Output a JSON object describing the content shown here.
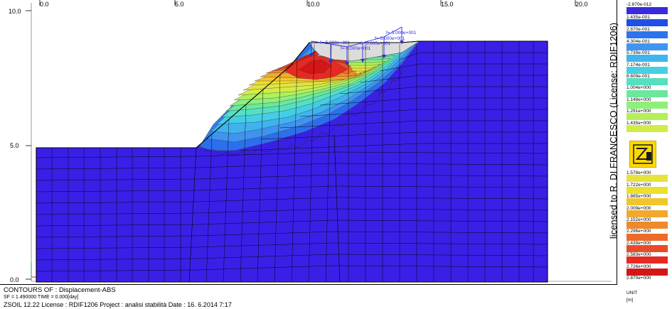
{
  "x_axis": {
    "ticks": [
      "0.0",
      "5.0",
      "10.0",
      "15.0",
      "20.0"
    ]
  },
  "y_axis": {
    "ticks": [
      "10.0",
      "5.0",
      "0.0"
    ]
  },
  "load_labels": [
    "f=-5.000e+001",
    "f=-5.000e+001",
    "f=-5.000e+001",
    "f=-5.000e+001",
    "f=-5.000e+001"
  ],
  "info": {
    "line1": "CONTOURS OF : Displacement-ABS",
    "line2": "SF = 1.490000   TIME = 0.000[day]",
    "line3": "ZSOIL 12.22   License :  RDIF1206   Project : analisi stabilità     Date : 16. 6.2014   7:17"
  },
  "legend": {
    "license_text": "licensed to R. DI FRANCESCO (License: RDIF1206)",
    "labels": [
      "-2.870e-012",
      "1.435e-001",
      "2.870e-001",
      "4.304e-001",
      "5.739e-001",
      "7.174e-001",
      "8.609e-001",
      "1.004e+000",
      "1.148e+000",
      "1.291e+000",
      "1.435e+000",
      "1.578e+000",
      "1.722e+000",
      "1.865e+000",
      "2.009e+000",
      "2.152e+000",
      "2.296e+000",
      "2.439e+000",
      "2.583e+000",
      "2.726e+000",
      "2.870e+000"
    ],
    "colors": [
      "#3a2ae0",
      "#1f4fe6",
      "#2b74ec",
      "#3f96f0",
      "#3fb4ee",
      "#45d0e4",
      "#55e0c0",
      "#6ae89c",
      "#8ef07a",
      "#b2f05a",
      "#d2ec46",
      "#e6e23e",
      "#ece02c",
      "#f0c62c",
      "#f2a82c",
      "#ee8a2a",
      "#ee6a28",
      "#ec4a26",
      "#e62a22",
      "#d41618",
      "#b0140e"
    ],
    "unit_label": "UNIT",
    "unit_value": "[m]",
    "logo_text": "ZS"
  }
}
